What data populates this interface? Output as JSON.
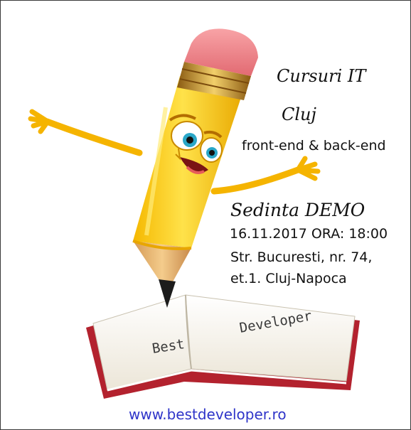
{
  "poster": {
    "headline": "Cursuri IT",
    "city": "Cluj",
    "tracks": "front-end & back-end",
    "session_title": "Sedinta DEMO",
    "datetime": "16.11.2017 ORA: 18:00",
    "address_line1": "Str. Bucuresti, nr. 74,",
    "address_line2": "et.1. Cluj-Napoca",
    "website": "www.bestdeveloper.ro"
  },
  "book": {
    "left_word": "Best",
    "right_word": "Developer"
  },
  "colors": {
    "pencil_yellow": "#f7cf1b",
    "eraser_pink": "#f2888d",
    "ferrule_gold": "#c9962b",
    "book_red": "#b3222e",
    "link_blue": "#2f35c9"
  },
  "icons": [
    "pencil-mascot",
    "open-book"
  ]
}
